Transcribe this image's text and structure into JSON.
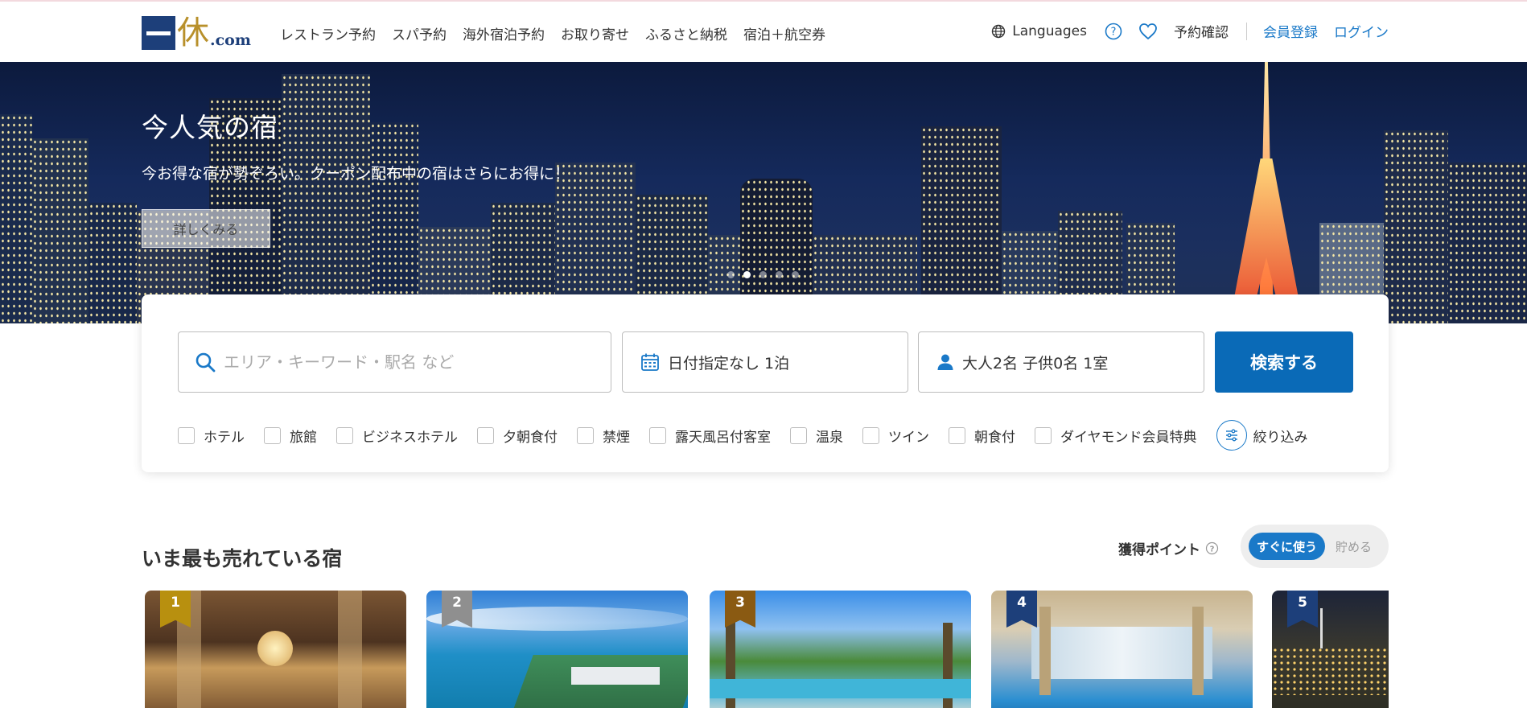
{
  "header": {
    "logo_kanji": "休",
    "logo_com": ".com",
    "nav": [
      "レストラン予約",
      "スパ予約",
      "海外宿泊予約",
      "お取り寄せ",
      "ふるさと納税",
      "宿泊＋航空券"
    ],
    "languages": "Languages",
    "reservation_check": "予約確認",
    "member_register": "会員登録",
    "login": "ログイン"
  },
  "hero": {
    "title": "今人気の宿",
    "subtitle": "今お得な宿が勢ぞろい。クーポン配布中の宿はさらにお得に！",
    "button": "詳しくみる",
    "slide_count": 5,
    "active_slide": 2
  },
  "search": {
    "keyword_placeholder": "エリア・キーワード・駅名 など",
    "date_value": "日付指定なし 1泊",
    "guest_value": "大人2名  子供0名  1室",
    "button": "検索する",
    "filters": [
      "ホテル",
      "旅館",
      "ビジネスホテル",
      "夕朝食付",
      "禁煙",
      "露天風呂付客室",
      "温泉",
      "ツイン",
      "朝食付",
      "ダイヤモンド会員特典"
    ],
    "narrow": "絞り込み"
  },
  "section": {
    "title": "いま最も売れている宿",
    "points_label": "獲得ポイント",
    "toggle_on": "すぐに使う",
    "toggle_off": "貯める"
  },
  "cards": [
    {
      "rank": "1",
      "badge_color": "#b8900f"
    },
    {
      "rank": "2",
      "badge_color": "#8f8f8f"
    },
    {
      "rank": "3",
      "badge_color": "#8a5a12"
    },
    {
      "rank": "4",
      "badge_color": "#1d3f7a"
    },
    {
      "rank": "5",
      "badge_color": "#1d3f7a"
    }
  ],
  "colors": {
    "accent": "#1a79c8",
    "search_button": "#0a6ab7",
    "brand_navy": "#1d3f7a",
    "brand_gold": "#b8902b"
  }
}
